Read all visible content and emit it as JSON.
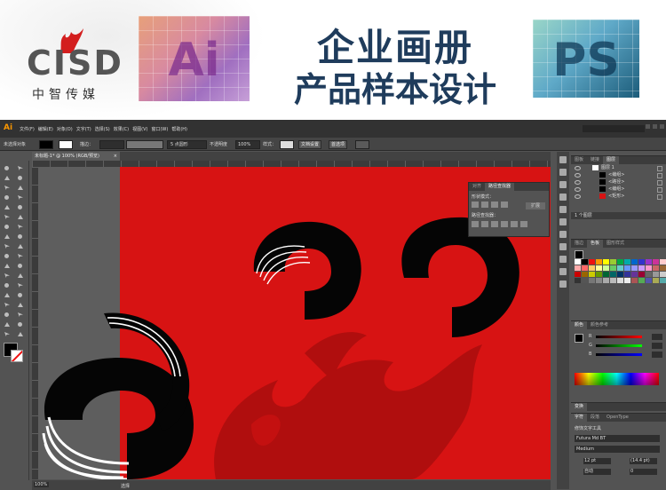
{
  "banner": {
    "logo_text": "CISD",
    "logo_cn": "中智传媒",
    "headline_line1": "企业画册",
    "headline_line2": "产品样本设计",
    "tile_ai": "Ai",
    "tile_ps": "PS"
  },
  "app": {
    "logo": "Ai",
    "menu": [
      "文件(F)",
      "编辑(E)",
      "对象(O)",
      "文字(T)",
      "选择(S)",
      "效果(C)",
      "视图(V)",
      "窗口(W)",
      "帮助(H)"
    ],
    "control_bar": {
      "selection": "未选择对象",
      "stroke_label": "描边：",
      "brush": "5 点圆形",
      "opacity_label": "不透明度",
      "opacity_value": "100%",
      "style_label": "样式：",
      "doc_setup": "文档设置",
      "preferences": "首选项"
    },
    "tab": {
      "label": "未标题-1* @ 100% (RGB/预览)",
      "close": "×"
    },
    "status": {
      "zoom": "100%",
      "tool": "选择"
    },
    "accent": "#f79500",
    "artboard_color": "#d71313"
  },
  "pathfinder": {
    "tabs": [
      "对齐",
      "路径查找器"
    ],
    "active_tab": 1,
    "shape_modes_label": "形状模式：",
    "pathfinders_label": "路径查找器：",
    "expand": "扩展"
  },
  "layers_panel": {
    "tabs": [
      "图板",
      "链接",
      "图层"
    ],
    "active_tab": 2,
    "layers": [
      {
        "name": "图层 1",
        "level": 0
      },
      {
        "name": "<编组>",
        "level": 1
      },
      {
        "name": "<路径>",
        "level": 1
      },
      {
        "name": "<编组>",
        "level": 1
      },
      {
        "name": "<矩形>",
        "level": 1
      }
    ],
    "footer": "1 个图层"
  },
  "swatches_panel": {
    "tabs": [
      "描边",
      "色板",
      "图形样式"
    ],
    "active_tab": 1
  },
  "color_panel": {
    "tabs": [
      "颜色",
      "颜色参考"
    ],
    "active_tab": 0,
    "channels": [
      "R",
      "G",
      "B"
    ]
  },
  "transform_panel": {
    "tab": "变换"
  },
  "character_panel": {
    "tabs": [
      "字符",
      "段落",
      "OpenType"
    ],
    "active_tab": 0,
    "tool_label": "修饰文字工具",
    "font_family": "Futura Md BT",
    "font_style": "Medium",
    "font_size": "12 pt",
    "leading": "(14.4 pt)",
    "tracking": "0",
    "kerning": "自动"
  }
}
